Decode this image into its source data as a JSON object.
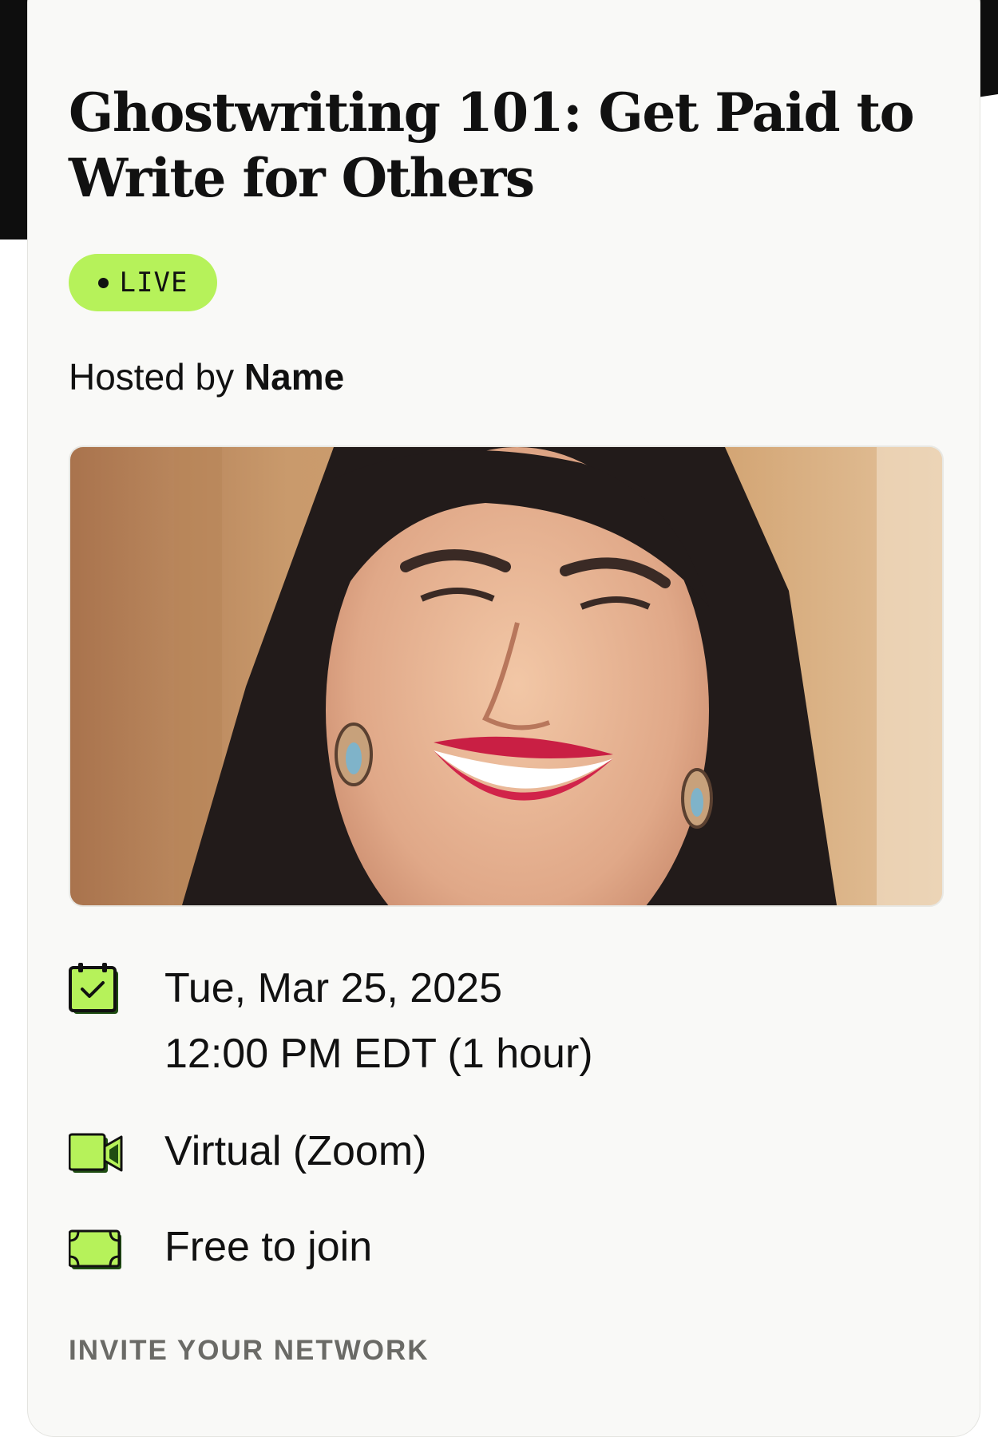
{
  "event": {
    "title": "Ghostwriting 101: Get Paid to Write for Others",
    "status_badge": "LIVE",
    "hosted_by_prefix": "Hosted by",
    "host_name": "Name",
    "date": "Tue, Mar 25, 2025",
    "time": "12:00 PM EDT (1 hour)",
    "location": "Virtual (Zoom)",
    "price": "Free to join"
  },
  "section": {
    "invite_heading": "INVITE YOUR NETWORK"
  },
  "icons": {
    "date": "calendar-check-icon",
    "location": "video-camera-icon",
    "price": "ticket-icon"
  },
  "colors": {
    "accent": "#b6f25a",
    "icon_dark_green": "#1f4d12",
    "card_bg": "#f9f9f7",
    "page_top_bg": "#0e0e0e"
  }
}
